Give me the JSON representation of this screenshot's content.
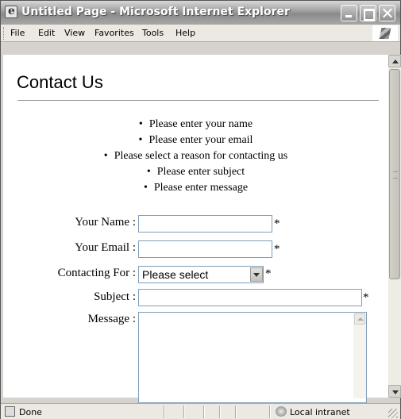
{
  "window": {
    "title": "Untitled Page - Microsoft Internet Explorer"
  },
  "menu": {
    "items": [
      "File",
      "Edit",
      "View",
      "Favorites",
      "Tools",
      "Help"
    ]
  },
  "page": {
    "title": "Contact Us",
    "validation_errors": [
      "Please enter your name",
      "Please enter your email",
      "Please select a reason for contacting us",
      "Please enter subject",
      "Please enter message"
    ]
  },
  "form": {
    "name_label": "Your Name :",
    "name_value": "",
    "email_label": "Your Email :",
    "email_value": "",
    "reason_label": "Contacting For :",
    "reason_selected": "Please select",
    "subject_label": "Subject :",
    "subject_value": "",
    "message_label": "Message :",
    "message_value": "",
    "required_mark": "*"
  },
  "statusbar": {
    "status": "Done",
    "zone": "Local intranet"
  }
}
